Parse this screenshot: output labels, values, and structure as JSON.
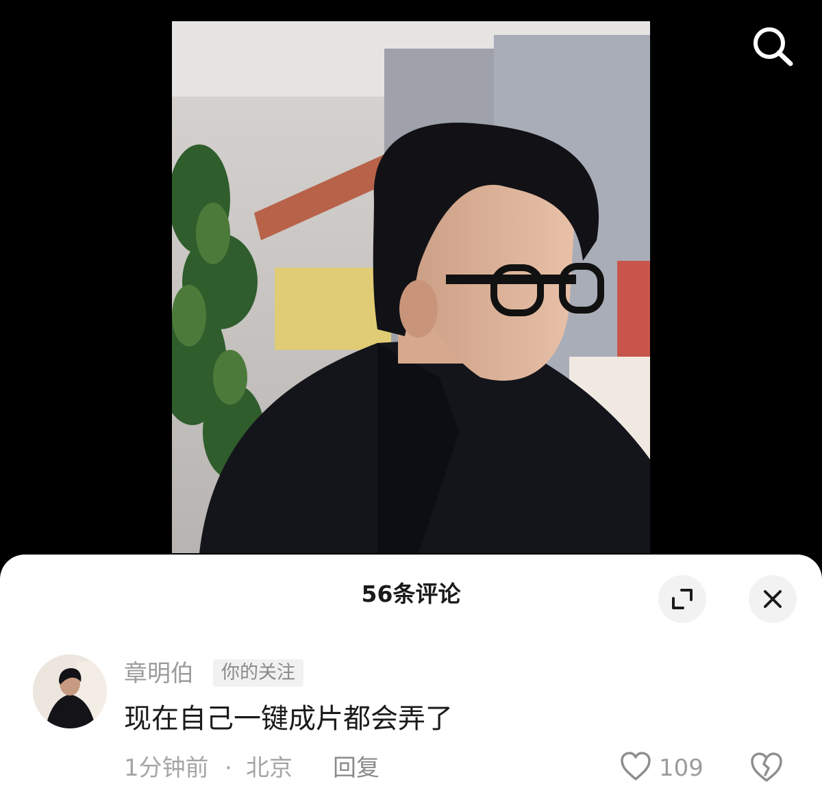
{
  "top_bar": {
    "search_icon": "search-icon"
  },
  "post_photo": {
    "kind": "portrait-photo"
  },
  "comments_sheet": {
    "title": "56条评论",
    "expand_icon": "expand-icon",
    "close_icon": "close-icon",
    "comments": [
      {
        "author": "章明伯",
        "tag": "你的关注",
        "text": "现在自己一键成片都会弄了",
        "time": "1分钟前",
        "separator": "·",
        "location": "北京",
        "reply_label": "回复",
        "like_count": "109",
        "like_icon": "heart-outline-icon",
        "dislike_icon": "broken-heart-icon"
      }
    ]
  },
  "colors": {
    "background": "#000000",
    "sheet": "#ffffff",
    "muted_text": "#9b9b9b",
    "primary_text": "#1a1a1a"
  }
}
